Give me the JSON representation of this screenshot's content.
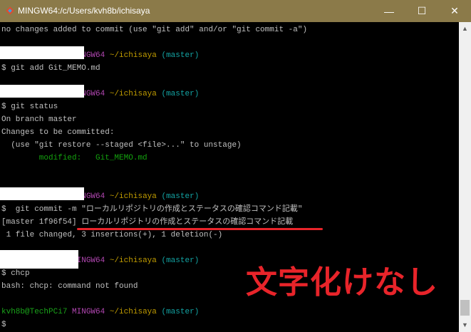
{
  "window": {
    "title": "MINGW64:/c/Users/kvh8b/ichisaya",
    "minimize": "—",
    "maximize": "☐",
    "close": "✕"
  },
  "prompt": {
    "user": "kvh8b@TechPCi7",
    "system": "MINGW64",
    "path": "~/ichisaya",
    "branch": "(master)"
  },
  "lines": {
    "l0": "no changes added to commit (use \"git add\" and/or \"git commit -a\")",
    "cmd1": "$ git add Git_MEMO.md",
    "cmd2": "$ git status",
    "s1": "On branch master",
    "s2": "Changes to be committed:",
    "s3": "  (use \"git restore --staged <file>...\" to unstage)",
    "s4_label": "        modified:   ",
    "s4_file": "Git_MEMO.md",
    "cmd3": "$  git commit -m \"ローカルリポジトリの作成とステータスの確認コマンド記載\"",
    "r1_prefix": "[master 1f96f54] ",
    "r1_msg": "ローカルリポジトリの作成とステータスの確認コマンド記載",
    "r2": " 1 file changed, 3 insertions(+), 1 deletion(-)",
    "cmd4": "$ chcp",
    "e1": "bash: chcp: command not found",
    "cmd5": "$"
  },
  "annotation": "文字化けなし",
  "colors": {
    "annotation": "#e8242a",
    "titlebar": "#8b7a49"
  }
}
